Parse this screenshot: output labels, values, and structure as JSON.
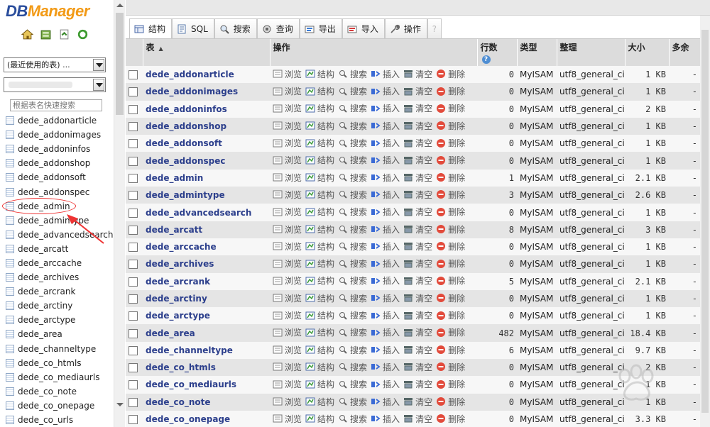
{
  "app": {
    "logo_part1": "DB",
    "logo_part2": "Manager"
  },
  "left": {
    "recent_tables": "(最近使用的表) ...",
    "filter_placeholder": "根据表名快速搜索",
    "tables": [
      "dede_addonarticle",
      "dede_addonimages",
      "dede_addoninfos",
      "dede_addonshop",
      "dede_addonsoft",
      "dede_addonspec",
      "dede_admin",
      "dede_admintype",
      "dede_advancedsearch",
      "dede_arcatt",
      "dede_arccache",
      "dede_archives",
      "dede_arcrank",
      "dede_arctiny",
      "dede_arctype",
      "dede_area",
      "dede_channeltype",
      "dede_co_htmls",
      "dede_co_mediaurls",
      "dede_co_note",
      "dede_co_onepage",
      "dede_co_urls"
    ]
  },
  "tabs": [
    {
      "label": "结构",
      "icon": "structure-icon"
    },
    {
      "label": "SQL",
      "icon": "sql-icon"
    },
    {
      "label": "搜索",
      "icon": "search-icon"
    },
    {
      "label": "查询",
      "icon": "query-icon"
    },
    {
      "label": "导出",
      "icon": "export-icon"
    },
    {
      "label": "导入",
      "icon": "import-icon"
    },
    {
      "label": "操作",
      "icon": "wrench-icon"
    },
    {
      "label": "?",
      "icon": "help-icon"
    }
  ],
  "columns": {
    "table": "表",
    "sort_indicator": "▲",
    "actions": "操作",
    "rows": "行数",
    "rows_help": "?",
    "type": "类型",
    "collation": "整理",
    "size": "大小",
    "overhead": "多余"
  },
  "actions": {
    "browse": "浏览",
    "structure": "结构",
    "search": "搜索",
    "insert": "插入",
    "empty": "清空",
    "drop": "删除"
  },
  "rows": [
    {
      "name": "dede_addonarticle",
      "count": "0",
      "engine": "MyISAM",
      "collation": "utf8_general_ci",
      "size": "1 KB",
      "overhead": "-"
    },
    {
      "name": "dede_addonimages",
      "count": "0",
      "engine": "MyISAM",
      "collation": "utf8_general_ci",
      "size": "1 KB",
      "overhead": "-"
    },
    {
      "name": "dede_addoninfos",
      "count": "0",
      "engine": "MyISAM",
      "collation": "utf8_general_ci",
      "size": "2 KB",
      "overhead": "-"
    },
    {
      "name": "dede_addonshop",
      "count": "0",
      "engine": "MyISAM",
      "collation": "utf8_general_ci",
      "size": "1 KB",
      "overhead": "-"
    },
    {
      "name": "dede_addonsoft",
      "count": "0",
      "engine": "MyISAM",
      "collation": "utf8_general_ci",
      "size": "1 KB",
      "overhead": "-"
    },
    {
      "name": "dede_addonspec",
      "count": "0",
      "engine": "MyISAM",
      "collation": "utf8_general_ci",
      "size": "1 KB",
      "overhead": "-"
    },
    {
      "name": "dede_admin",
      "count": "1",
      "engine": "MyISAM",
      "collation": "utf8_general_ci",
      "size": "2.1 KB",
      "overhead": "-"
    },
    {
      "name": "dede_admintype",
      "count": "3",
      "engine": "MyISAM",
      "collation": "utf8_general_ci",
      "size": "2.6 KB",
      "overhead": "-"
    },
    {
      "name": "dede_advancedsearch",
      "count": "0",
      "engine": "MyISAM",
      "collation": "utf8_general_ci",
      "size": "1 KB",
      "overhead": "-"
    },
    {
      "name": "dede_arcatt",
      "count": "8",
      "engine": "MyISAM",
      "collation": "utf8_general_ci",
      "size": "3 KB",
      "overhead": "-"
    },
    {
      "name": "dede_arccache",
      "count": "0",
      "engine": "MyISAM",
      "collation": "utf8_general_ci",
      "size": "1 KB",
      "overhead": "-"
    },
    {
      "name": "dede_archives",
      "count": "0",
      "engine": "MyISAM",
      "collation": "utf8_general_ci",
      "size": "1 KB",
      "overhead": "-"
    },
    {
      "name": "dede_arcrank",
      "count": "5",
      "engine": "MyISAM",
      "collation": "utf8_general_ci",
      "size": "2.1 KB",
      "overhead": "-"
    },
    {
      "name": "dede_arctiny",
      "count": "0",
      "engine": "MyISAM",
      "collation": "utf8_general_ci",
      "size": "1 KB",
      "overhead": "-"
    },
    {
      "name": "dede_arctype",
      "count": "0",
      "engine": "MyISAM",
      "collation": "utf8_general_ci",
      "size": "1 KB",
      "overhead": "-"
    },
    {
      "name": "dede_area",
      "count": "482",
      "engine": "MyISAM",
      "collation": "utf8_general_ci",
      "size": "18.4 KB",
      "overhead": "-"
    },
    {
      "name": "dede_channeltype",
      "count": "6",
      "engine": "MyISAM",
      "collation": "utf8_general_ci",
      "size": "9.7 KB",
      "overhead": "-"
    },
    {
      "name": "dede_co_htmls",
      "count": "0",
      "engine": "MyISAM",
      "collation": "utf8_general_ci",
      "size": "2 KB",
      "overhead": "-"
    },
    {
      "name": "dede_co_mediaurls",
      "count": "0",
      "engine": "MyISAM",
      "collation": "utf8_general_ci",
      "size": "1 KB",
      "overhead": "-"
    },
    {
      "name": "dede_co_note",
      "count": "0",
      "engine": "MyISAM",
      "collation": "utf8_general_ci",
      "size": "1 KB",
      "overhead": "-"
    },
    {
      "name": "dede_co_onepage",
      "count": "0",
      "engine": "MyISAM",
      "collation": "utf8_general_ci",
      "size": "3.3 KB",
      "overhead": "-"
    }
  ],
  "colors": {
    "table_link": "#2c3f8c",
    "highlight": "#e33333",
    "logo_blue": "#2a4d9c",
    "logo_orange": "#f29a16"
  }
}
